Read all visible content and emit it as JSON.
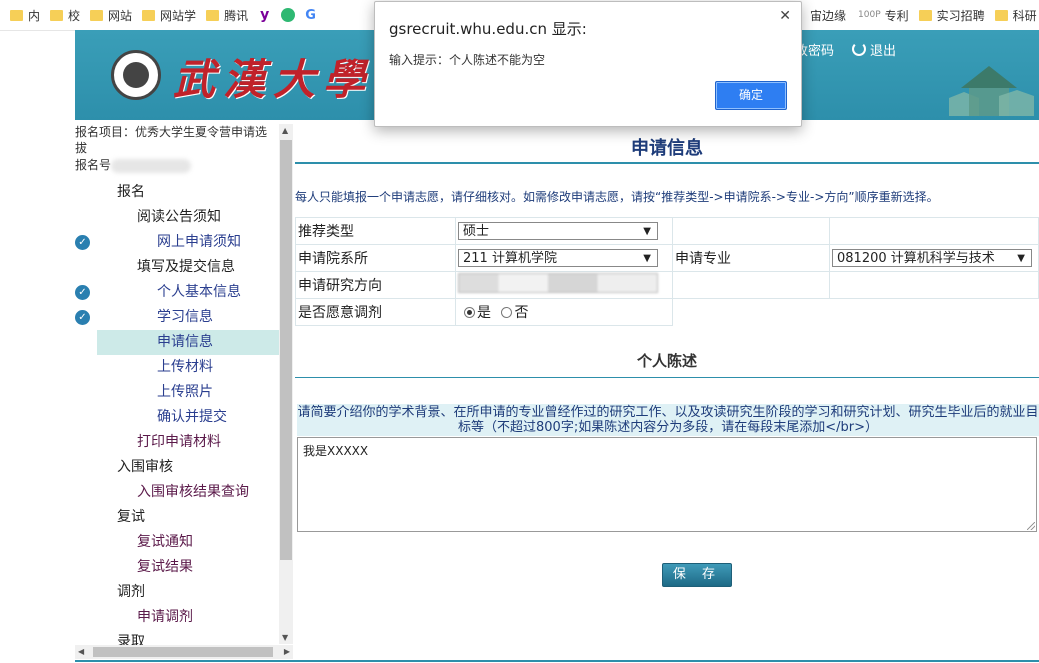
{
  "bookmarks": {
    "left": [
      "内",
      "校",
      "网站",
      "网站学",
      "腾讯"
    ],
    "g_label": "G",
    "right": [
      "宙边缘",
      "专利",
      "实习招聘",
      "科研"
    ],
    "p100_label": "100P"
  },
  "header": {
    "logo_text": "武漢大學",
    "change_password": "改密码",
    "logout": "退出"
  },
  "sidebar": {
    "project": "报名项目：优秀大学生夏令营申请选拔",
    "regno_label": "报名号",
    "menu": [
      {
        "label": "报名"
      },
      {
        "label": "阅读公告须知"
      },
      {
        "label": "网上申请须知"
      },
      {
        "label": "填写及提交信息"
      },
      {
        "label": "个人基本信息"
      },
      {
        "label": "学习信息"
      },
      {
        "label": "申请信息"
      },
      {
        "label": "上传材料"
      },
      {
        "label": "上传照片"
      },
      {
        "label": "确认并提交"
      },
      {
        "label": "打印申请材料"
      },
      {
        "label": "入围审核"
      },
      {
        "label": "入围审核结果查询"
      },
      {
        "label": "复试"
      },
      {
        "label": "复试通知"
      },
      {
        "label": "复试结果"
      },
      {
        "label": "调剂"
      },
      {
        "label": "申请调剂"
      },
      {
        "label": "录取"
      }
    ]
  },
  "main": {
    "title": "申请信息",
    "notice": "每人只能填报一个申请志愿，请仔细核对。如需修改申请志愿，请按“推荐类型->申请院系->专业->方向”顺序重新选择。",
    "form": {
      "type_label": "推荐类型",
      "type_value": "硕士",
      "dept_label": "申请院系所",
      "dept_value": "211 计算机学院",
      "major_label": "申请专业",
      "major_value": "081200 计算机科学与技术",
      "direction_label": "申请研究方向",
      "adjust_label": "是否愿意调剂",
      "adjust_yes": "是",
      "adjust_no": "否"
    },
    "statement_title": "个人陈述",
    "statement_hint": "请简要介绍你的学术背景、在所申请的专业曾经作过的研究工作、以及攻读研究生阶段的学习和研究计划、研究生毕业后的就业目标等（不超过800字;如果陈述内容分为多段，请在每段末尾添加</br>）",
    "statement_value": "我是XXXXX",
    "save_label": "保 存"
  },
  "dialog": {
    "title": "gsrecruit.whu.edu.cn 显示:",
    "message": "输入提示：个人陈述不能为空",
    "ok_label": "确定"
  },
  "colors": {
    "header_bg": "#2d8fab",
    "logo_red": "#c0222a",
    "dialog_ok": "#2e7ef2",
    "active_menu_bg": "#cdeae8"
  }
}
